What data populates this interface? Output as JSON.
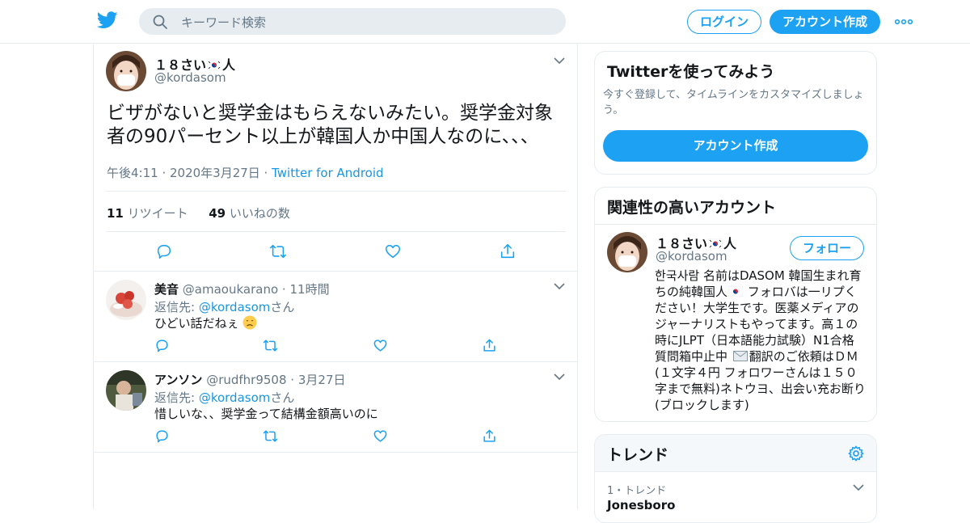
{
  "topbar": {
    "search_placeholder": "キーワード検索",
    "login_label": "ログイン",
    "signup_label": "アカウント作成"
  },
  "tweet": {
    "author_name_prefix": "１８さい",
    "author_name_suffix": "人",
    "author_handle": "@kordasom",
    "text": "ビザがないと奨学金はもらえないみたい。奨学金対象者の90パーセント以上が韓国人か中国人なのに、、、",
    "time": "午後4:11 · 2020年3月27日 · ",
    "source": "Twitter for Android",
    "retweet_count": "11",
    "retweet_label": "リツイート",
    "like_count": "49",
    "like_label": "いいねの数"
  },
  "replies": [
    {
      "name": "美音",
      "handle": "@amaoukarano",
      "time": "11時間",
      "reply_prefix": "返信先: ",
      "reply_handle": "@kordasom",
      "reply_suffix": "さん",
      "text": "ひどい話だねぇ",
      "emoji": "disappointed-face"
    },
    {
      "name": "アンソン",
      "handle": "@rudfhr9508",
      "time": "3月27日",
      "reply_prefix": "返信先: ",
      "reply_handle": "@kordasom",
      "reply_suffix": "さん",
      "text": "惜しいな、、奨学金って結構金額高いのに"
    }
  ],
  "sidebar": {
    "signup_card": {
      "title": "Twitterを使ってみよう",
      "subtitle": "今すぐ登録して、タイムラインをカスタマイズしましょう。",
      "button": "アカウント作成"
    },
    "related_card": {
      "title": "関連性の高いアカウント",
      "name_prefix": "１８さい",
      "name_suffix": "人",
      "handle": "@kordasom",
      "follow_label": "フォロー",
      "bio_1": "한국사람 名前はDASOM 韓国生まれ育ちの純韓国人",
      "bio_2": " フォロバは一リプください！大学生です。医薬メディアのジャーナリストもやってます。高１の時にJLPT（日本語能力試験）N1合格 質問箱中止中 ",
      "bio_3": "翻訳のご依頼はＤＭ(１文字４円 フォロワーさんは１５０字まで無料)ネトウヨ、出会い充お断り(ブロックします)"
    },
    "trends_card": {
      "title": "トレンド",
      "items": [
        {
          "rank_label": "1・トレンド",
          "name": "Jonesboro"
        }
      ]
    }
  },
  "colors": {
    "accent": "#1da1f2",
    "link": "#1b95e0",
    "muted": "#657786",
    "border": "#e6ecf0"
  }
}
